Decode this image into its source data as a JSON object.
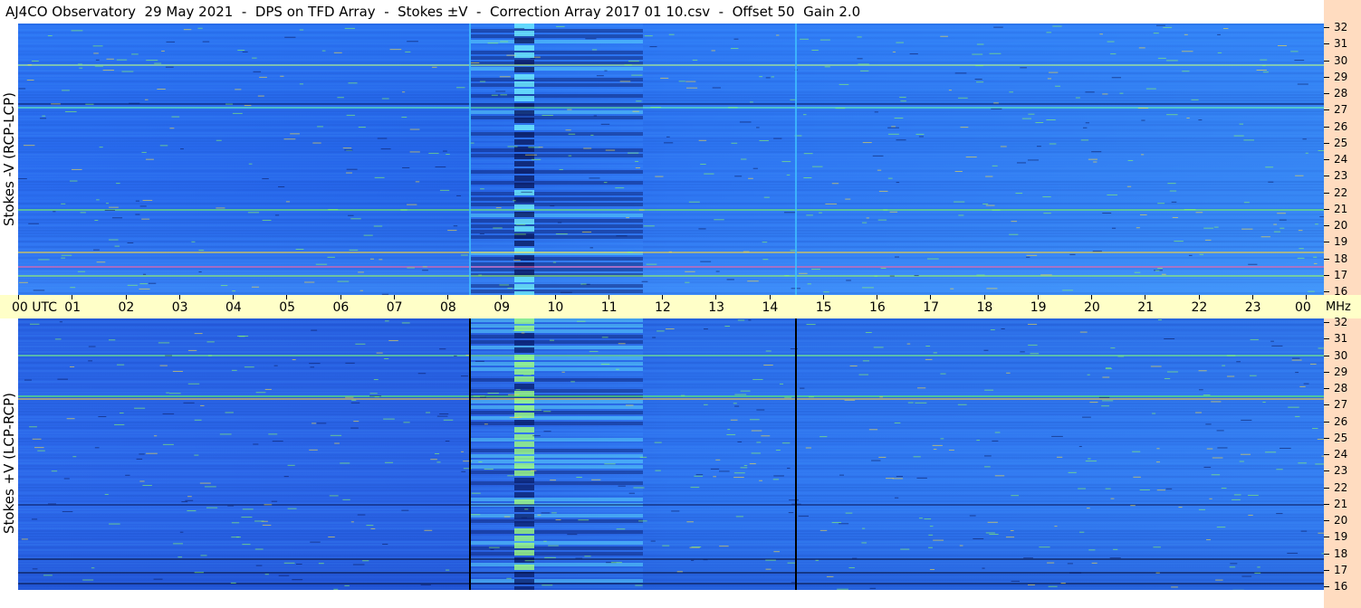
{
  "title": "AJ4CO Observatory  29 May 2021  -  DPS on TFD Array  -  Stokes ±V  -  Correction Array 2017 01 10.csv  -  Offset 50  Gain 2.0",
  "top_panel": {
    "label": "Stokes -V (RCP-LCP)"
  },
  "bottom_panel": {
    "label": "Stokes +V (LCP-RCP)"
  },
  "time_axis": {
    "labels": [
      "00 UTC",
      "01",
      "02",
      "03",
      "04",
      "05",
      "06",
      "07",
      "08",
      "09",
      "10",
      "11",
      "12",
      "13",
      "14",
      "15",
      "16",
      "17",
      "18",
      "19",
      "20",
      "21",
      "22",
      "23",
      "00"
    ],
    "unit": "MHz"
  },
  "freq_axis": {
    "labels": [
      "32",
      "31",
      "30",
      "29",
      "28",
      "27",
      "26",
      "25",
      "24",
      "23",
      "22",
      "21",
      "20",
      "19",
      "18",
      "17",
      "16"
    ],
    "min_mhz": 16,
    "max_mhz": 32
  },
  "colors": {
    "background": "#2a6cf0",
    "axis_bg": "#ffffc8",
    "freq_axis_bg": "#ffdcc0"
  }
}
